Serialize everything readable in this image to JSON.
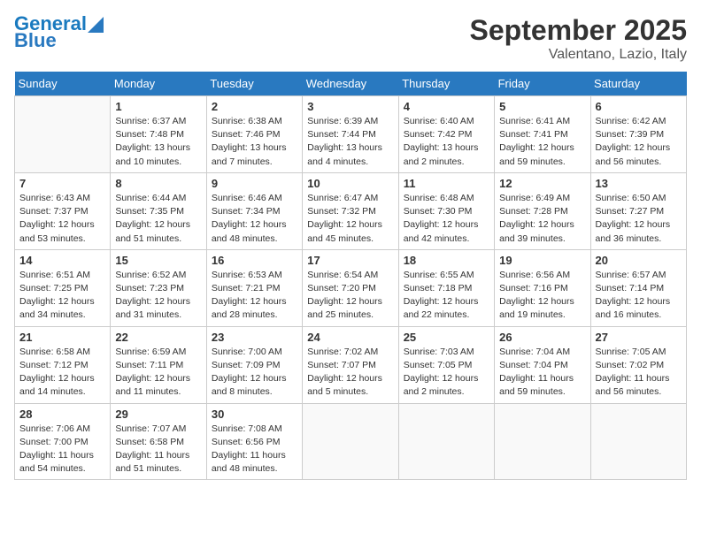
{
  "header": {
    "logo_line1": "General",
    "logo_line2": "Blue",
    "month_title": "September 2025",
    "location": "Valentano, Lazio, Italy"
  },
  "days_of_week": [
    "Sunday",
    "Monday",
    "Tuesday",
    "Wednesday",
    "Thursday",
    "Friday",
    "Saturday"
  ],
  "weeks": [
    [
      {
        "num": "",
        "info": ""
      },
      {
        "num": "1",
        "info": "Sunrise: 6:37 AM\nSunset: 7:48 PM\nDaylight: 13 hours\nand 10 minutes."
      },
      {
        "num": "2",
        "info": "Sunrise: 6:38 AM\nSunset: 7:46 PM\nDaylight: 13 hours\nand 7 minutes."
      },
      {
        "num": "3",
        "info": "Sunrise: 6:39 AM\nSunset: 7:44 PM\nDaylight: 13 hours\nand 4 minutes."
      },
      {
        "num": "4",
        "info": "Sunrise: 6:40 AM\nSunset: 7:42 PM\nDaylight: 13 hours\nand 2 minutes."
      },
      {
        "num": "5",
        "info": "Sunrise: 6:41 AM\nSunset: 7:41 PM\nDaylight: 12 hours\nand 59 minutes."
      },
      {
        "num": "6",
        "info": "Sunrise: 6:42 AM\nSunset: 7:39 PM\nDaylight: 12 hours\nand 56 minutes."
      }
    ],
    [
      {
        "num": "7",
        "info": "Sunrise: 6:43 AM\nSunset: 7:37 PM\nDaylight: 12 hours\nand 53 minutes."
      },
      {
        "num": "8",
        "info": "Sunrise: 6:44 AM\nSunset: 7:35 PM\nDaylight: 12 hours\nand 51 minutes."
      },
      {
        "num": "9",
        "info": "Sunrise: 6:46 AM\nSunset: 7:34 PM\nDaylight: 12 hours\nand 48 minutes."
      },
      {
        "num": "10",
        "info": "Sunrise: 6:47 AM\nSunset: 7:32 PM\nDaylight: 12 hours\nand 45 minutes."
      },
      {
        "num": "11",
        "info": "Sunrise: 6:48 AM\nSunset: 7:30 PM\nDaylight: 12 hours\nand 42 minutes."
      },
      {
        "num": "12",
        "info": "Sunrise: 6:49 AM\nSunset: 7:28 PM\nDaylight: 12 hours\nand 39 minutes."
      },
      {
        "num": "13",
        "info": "Sunrise: 6:50 AM\nSunset: 7:27 PM\nDaylight: 12 hours\nand 36 minutes."
      }
    ],
    [
      {
        "num": "14",
        "info": "Sunrise: 6:51 AM\nSunset: 7:25 PM\nDaylight: 12 hours\nand 34 minutes."
      },
      {
        "num": "15",
        "info": "Sunrise: 6:52 AM\nSunset: 7:23 PM\nDaylight: 12 hours\nand 31 minutes."
      },
      {
        "num": "16",
        "info": "Sunrise: 6:53 AM\nSunset: 7:21 PM\nDaylight: 12 hours\nand 28 minutes."
      },
      {
        "num": "17",
        "info": "Sunrise: 6:54 AM\nSunset: 7:20 PM\nDaylight: 12 hours\nand 25 minutes."
      },
      {
        "num": "18",
        "info": "Sunrise: 6:55 AM\nSunset: 7:18 PM\nDaylight: 12 hours\nand 22 minutes."
      },
      {
        "num": "19",
        "info": "Sunrise: 6:56 AM\nSunset: 7:16 PM\nDaylight: 12 hours\nand 19 minutes."
      },
      {
        "num": "20",
        "info": "Sunrise: 6:57 AM\nSunset: 7:14 PM\nDaylight: 12 hours\nand 16 minutes."
      }
    ],
    [
      {
        "num": "21",
        "info": "Sunrise: 6:58 AM\nSunset: 7:12 PM\nDaylight: 12 hours\nand 14 minutes."
      },
      {
        "num": "22",
        "info": "Sunrise: 6:59 AM\nSunset: 7:11 PM\nDaylight: 12 hours\nand 11 minutes."
      },
      {
        "num": "23",
        "info": "Sunrise: 7:00 AM\nSunset: 7:09 PM\nDaylight: 12 hours\nand 8 minutes."
      },
      {
        "num": "24",
        "info": "Sunrise: 7:02 AM\nSunset: 7:07 PM\nDaylight: 12 hours\nand 5 minutes."
      },
      {
        "num": "25",
        "info": "Sunrise: 7:03 AM\nSunset: 7:05 PM\nDaylight: 12 hours\nand 2 minutes."
      },
      {
        "num": "26",
        "info": "Sunrise: 7:04 AM\nSunset: 7:04 PM\nDaylight: 11 hours\nand 59 minutes."
      },
      {
        "num": "27",
        "info": "Sunrise: 7:05 AM\nSunset: 7:02 PM\nDaylight: 11 hours\nand 56 minutes."
      }
    ],
    [
      {
        "num": "28",
        "info": "Sunrise: 7:06 AM\nSunset: 7:00 PM\nDaylight: 11 hours\nand 54 minutes."
      },
      {
        "num": "29",
        "info": "Sunrise: 7:07 AM\nSunset: 6:58 PM\nDaylight: 11 hours\nand 51 minutes."
      },
      {
        "num": "30",
        "info": "Sunrise: 7:08 AM\nSunset: 6:56 PM\nDaylight: 11 hours\nand 48 minutes."
      },
      {
        "num": "",
        "info": ""
      },
      {
        "num": "",
        "info": ""
      },
      {
        "num": "",
        "info": ""
      },
      {
        "num": "",
        "info": ""
      }
    ]
  ]
}
